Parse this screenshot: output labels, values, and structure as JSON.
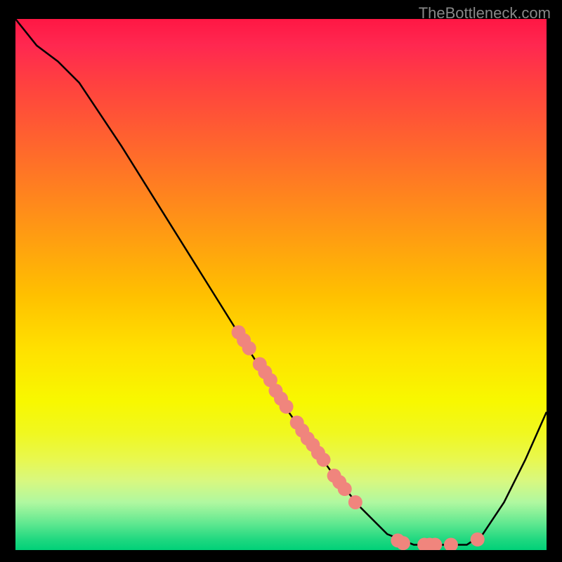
{
  "attribution": "TheBottleneck.com",
  "chart_data": {
    "type": "line",
    "title": "",
    "xlabel": "",
    "ylabel": "",
    "xlim": [
      0,
      100
    ],
    "ylim": [
      0,
      100
    ],
    "grid": false,
    "background_gradient": {
      "top": "#ff1744",
      "mid": "#ffE000",
      "bottom": "#00d078"
    },
    "curve": {
      "color": "#000000",
      "points": [
        {
          "x": 0,
          "y": 100
        },
        {
          "x": 4,
          "y": 95
        },
        {
          "x": 8,
          "y": 92
        },
        {
          "x": 12,
          "y": 88
        },
        {
          "x": 16,
          "y": 82
        },
        {
          "x": 20,
          "y": 76
        },
        {
          "x": 25,
          "y": 68
        },
        {
          "x": 30,
          "y": 60
        },
        {
          "x": 35,
          "y": 52
        },
        {
          "x": 40,
          "y": 44
        },
        {
          "x": 45,
          "y": 36
        },
        {
          "x": 50,
          "y": 28
        },
        {
          "x": 55,
          "y": 21
        },
        {
          "x": 60,
          "y": 14
        },
        {
          "x": 65,
          "y": 8
        },
        {
          "x": 70,
          "y": 3
        },
        {
          "x": 75,
          "y": 1
        },
        {
          "x": 80,
          "y": 1
        },
        {
          "x": 85,
          "y": 1
        },
        {
          "x": 88,
          "y": 3
        },
        {
          "x": 92,
          "y": 9
        },
        {
          "x": 96,
          "y": 17
        },
        {
          "x": 100,
          "y": 26
        }
      ]
    },
    "markers": {
      "color": "#f0857d",
      "radius": 10,
      "points": [
        {
          "x": 42,
          "y": 41
        },
        {
          "x": 43,
          "y": 39.5
        },
        {
          "x": 44,
          "y": 38
        },
        {
          "x": 46,
          "y": 35
        },
        {
          "x": 47,
          "y": 33.5
        },
        {
          "x": 48,
          "y": 32
        },
        {
          "x": 49,
          "y": 30
        },
        {
          "x": 50,
          "y": 28.5
        },
        {
          "x": 51,
          "y": 27
        },
        {
          "x": 53,
          "y": 24
        },
        {
          "x": 54,
          "y": 22.5
        },
        {
          "x": 55,
          "y": 21
        },
        {
          "x": 56,
          "y": 19.8
        },
        {
          "x": 57,
          "y": 18.3
        },
        {
          "x": 58,
          "y": 17
        },
        {
          "x": 60,
          "y": 14
        },
        {
          "x": 61,
          "y": 12.8
        },
        {
          "x": 62,
          "y": 11.5
        },
        {
          "x": 64,
          "y": 9
        },
        {
          "x": 72,
          "y": 1.8
        },
        {
          "x": 73,
          "y": 1.3
        },
        {
          "x": 77,
          "y": 1
        },
        {
          "x": 78,
          "y": 1
        },
        {
          "x": 79,
          "y": 1
        },
        {
          "x": 82,
          "y": 1
        },
        {
          "x": 87,
          "y": 2
        }
      ]
    }
  }
}
